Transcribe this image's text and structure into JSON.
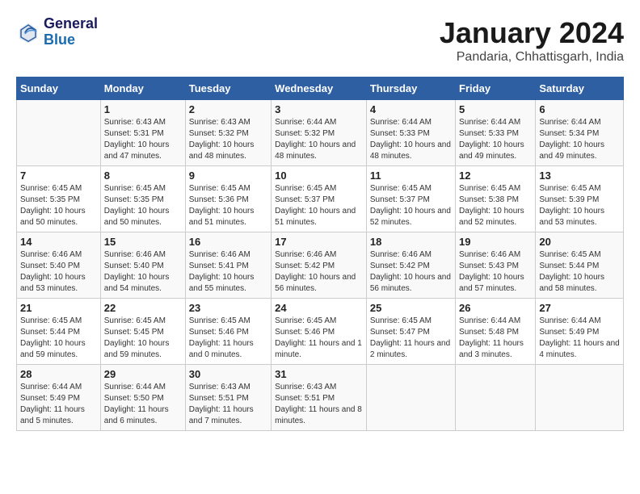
{
  "logo": {
    "line1": "General",
    "line2": "Blue"
  },
  "title": "January 2024",
  "subtitle": "Pandaria, Chhattisgarh, India",
  "columns": [
    "Sunday",
    "Monday",
    "Tuesday",
    "Wednesday",
    "Thursday",
    "Friday",
    "Saturday"
  ],
  "weeks": [
    [
      {
        "day": "",
        "sunrise": "",
        "sunset": "",
        "daylight": ""
      },
      {
        "day": "1",
        "sunrise": "Sunrise: 6:43 AM",
        "sunset": "Sunset: 5:31 PM",
        "daylight": "Daylight: 10 hours and 47 minutes."
      },
      {
        "day": "2",
        "sunrise": "Sunrise: 6:43 AM",
        "sunset": "Sunset: 5:32 PM",
        "daylight": "Daylight: 10 hours and 48 minutes."
      },
      {
        "day": "3",
        "sunrise": "Sunrise: 6:44 AM",
        "sunset": "Sunset: 5:32 PM",
        "daylight": "Daylight: 10 hours and 48 minutes."
      },
      {
        "day": "4",
        "sunrise": "Sunrise: 6:44 AM",
        "sunset": "Sunset: 5:33 PM",
        "daylight": "Daylight: 10 hours and 48 minutes."
      },
      {
        "day": "5",
        "sunrise": "Sunrise: 6:44 AM",
        "sunset": "Sunset: 5:33 PM",
        "daylight": "Daylight: 10 hours and 49 minutes."
      },
      {
        "day": "6",
        "sunrise": "Sunrise: 6:44 AM",
        "sunset": "Sunset: 5:34 PM",
        "daylight": "Daylight: 10 hours and 49 minutes."
      }
    ],
    [
      {
        "day": "7",
        "sunrise": "Sunrise: 6:45 AM",
        "sunset": "Sunset: 5:35 PM",
        "daylight": "Daylight: 10 hours and 50 minutes."
      },
      {
        "day": "8",
        "sunrise": "Sunrise: 6:45 AM",
        "sunset": "Sunset: 5:35 PM",
        "daylight": "Daylight: 10 hours and 50 minutes."
      },
      {
        "day": "9",
        "sunrise": "Sunrise: 6:45 AM",
        "sunset": "Sunset: 5:36 PM",
        "daylight": "Daylight: 10 hours and 51 minutes."
      },
      {
        "day": "10",
        "sunrise": "Sunrise: 6:45 AM",
        "sunset": "Sunset: 5:37 PM",
        "daylight": "Daylight: 10 hours and 51 minutes."
      },
      {
        "day": "11",
        "sunrise": "Sunrise: 6:45 AM",
        "sunset": "Sunset: 5:37 PM",
        "daylight": "Daylight: 10 hours and 52 minutes."
      },
      {
        "day": "12",
        "sunrise": "Sunrise: 6:45 AM",
        "sunset": "Sunset: 5:38 PM",
        "daylight": "Daylight: 10 hours and 52 minutes."
      },
      {
        "day": "13",
        "sunrise": "Sunrise: 6:45 AM",
        "sunset": "Sunset: 5:39 PM",
        "daylight": "Daylight: 10 hours and 53 minutes."
      }
    ],
    [
      {
        "day": "14",
        "sunrise": "Sunrise: 6:46 AM",
        "sunset": "Sunset: 5:40 PM",
        "daylight": "Daylight: 10 hours and 53 minutes."
      },
      {
        "day": "15",
        "sunrise": "Sunrise: 6:46 AM",
        "sunset": "Sunset: 5:40 PM",
        "daylight": "Daylight: 10 hours and 54 minutes."
      },
      {
        "day": "16",
        "sunrise": "Sunrise: 6:46 AM",
        "sunset": "Sunset: 5:41 PM",
        "daylight": "Daylight: 10 hours and 55 minutes."
      },
      {
        "day": "17",
        "sunrise": "Sunrise: 6:46 AM",
        "sunset": "Sunset: 5:42 PM",
        "daylight": "Daylight: 10 hours and 56 minutes."
      },
      {
        "day": "18",
        "sunrise": "Sunrise: 6:46 AM",
        "sunset": "Sunset: 5:42 PM",
        "daylight": "Daylight: 10 hours and 56 minutes."
      },
      {
        "day": "19",
        "sunrise": "Sunrise: 6:46 AM",
        "sunset": "Sunset: 5:43 PM",
        "daylight": "Daylight: 10 hours and 57 minutes."
      },
      {
        "day": "20",
        "sunrise": "Sunrise: 6:45 AM",
        "sunset": "Sunset: 5:44 PM",
        "daylight": "Daylight: 10 hours and 58 minutes."
      }
    ],
    [
      {
        "day": "21",
        "sunrise": "Sunrise: 6:45 AM",
        "sunset": "Sunset: 5:44 PM",
        "daylight": "Daylight: 10 hours and 59 minutes."
      },
      {
        "day": "22",
        "sunrise": "Sunrise: 6:45 AM",
        "sunset": "Sunset: 5:45 PM",
        "daylight": "Daylight: 10 hours and 59 minutes."
      },
      {
        "day": "23",
        "sunrise": "Sunrise: 6:45 AM",
        "sunset": "Sunset: 5:46 PM",
        "daylight": "Daylight: 11 hours and 0 minutes."
      },
      {
        "day": "24",
        "sunrise": "Sunrise: 6:45 AM",
        "sunset": "Sunset: 5:46 PM",
        "daylight": "Daylight: 11 hours and 1 minute."
      },
      {
        "day": "25",
        "sunrise": "Sunrise: 6:45 AM",
        "sunset": "Sunset: 5:47 PM",
        "daylight": "Daylight: 11 hours and 2 minutes."
      },
      {
        "day": "26",
        "sunrise": "Sunrise: 6:44 AM",
        "sunset": "Sunset: 5:48 PM",
        "daylight": "Daylight: 11 hours and 3 minutes."
      },
      {
        "day": "27",
        "sunrise": "Sunrise: 6:44 AM",
        "sunset": "Sunset: 5:49 PM",
        "daylight": "Daylight: 11 hours and 4 minutes."
      }
    ],
    [
      {
        "day": "28",
        "sunrise": "Sunrise: 6:44 AM",
        "sunset": "Sunset: 5:49 PM",
        "daylight": "Daylight: 11 hours and 5 minutes."
      },
      {
        "day": "29",
        "sunrise": "Sunrise: 6:44 AM",
        "sunset": "Sunset: 5:50 PM",
        "daylight": "Daylight: 11 hours and 6 minutes."
      },
      {
        "day": "30",
        "sunrise": "Sunrise: 6:43 AM",
        "sunset": "Sunset: 5:51 PM",
        "daylight": "Daylight: 11 hours and 7 minutes."
      },
      {
        "day": "31",
        "sunrise": "Sunrise: 6:43 AM",
        "sunset": "Sunset: 5:51 PM",
        "daylight": "Daylight: 11 hours and 8 minutes."
      },
      {
        "day": "",
        "sunrise": "",
        "sunset": "",
        "daylight": ""
      },
      {
        "day": "",
        "sunrise": "",
        "sunset": "",
        "daylight": ""
      },
      {
        "day": "",
        "sunrise": "",
        "sunset": "",
        "daylight": ""
      }
    ]
  ]
}
